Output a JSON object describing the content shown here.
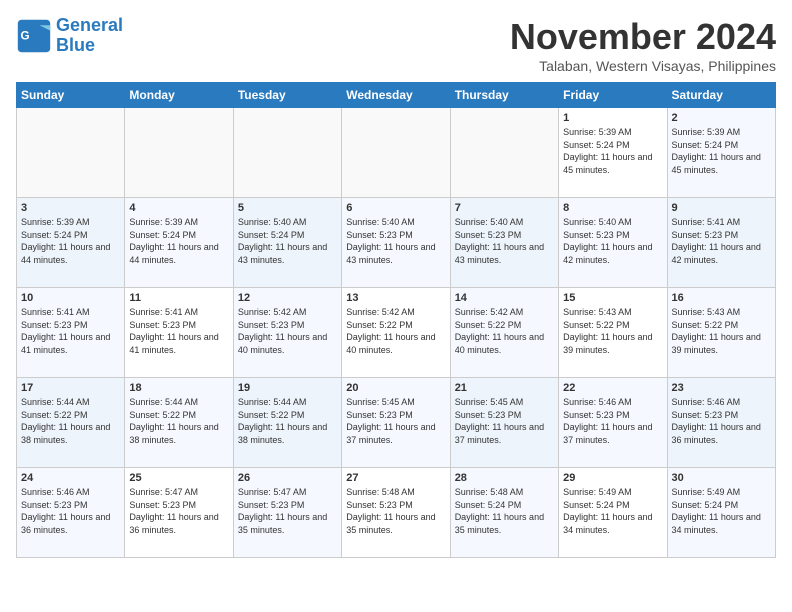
{
  "header": {
    "logo_line1": "General",
    "logo_line2": "Blue",
    "month": "November 2024",
    "location": "Talaban, Western Visayas, Philippines"
  },
  "weekdays": [
    "Sunday",
    "Monday",
    "Tuesday",
    "Wednesday",
    "Thursday",
    "Friday",
    "Saturday"
  ],
  "weeks": [
    [
      {
        "day": "",
        "info": ""
      },
      {
        "day": "",
        "info": ""
      },
      {
        "day": "",
        "info": ""
      },
      {
        "day": "",
        "info": ""
      },
      {
        "day": "",
        "info": ""
      },
      {
        "day": "1",
        "info": "Sunrise: 5:39 AM\nSunset: 5:24 PM\nDaylight: 11 hours and 45 minutes."
      },
      {
        "day": "2",
        "info": "Sunrise: 5:39 AM\nSunset: 5:24 PM\nDaylight: 11 hours and 45 minutes."
      }
    ],
    [
      {
        "day": "3",
        "info": "Sunrise: 5:39 AM\nSunset: 5:24 PM\nDaylight: 11 hours and 44 minutes."
      },
      {
        "day": "4",
        "info": "Sunrise: 5:39 AM\nSunset: 5:24 PM\nDaylight: 11 hours and 44 minutes."
      },
      {
        "day": "5",
        "info": "Sunrise: 5:40 AM\nSunset: 5:24 PM\nDaylight: 11 hours and 43 minutes."
      },
      {
        "day": "6",
        "info": "Sunrise: 5:40 AM\nSunset: 5:23 PM\nDaylight: 11 hours and 43 minutes."
      },
      {
        "day": "7",
        "info": "Sunrise: 5:40 AM\nSunset: 5:23 PM\nDaylight: 11 hours and 43 minutes."
      },
      {
        "day": "8",
        "info": "Sunrise: 5:40 AM\nSunset: 5:23 PM\nDaylight: 11 hours and 42 minutes."
      },
      {
        "day": "9",
        "info": "Sunrise: 5:41 AM\nSunset: 5:23 PM\nDaylight: 11 hours and 42 minutes."
      }
    ],
    [
      {
        "day": "10",
        "info": "Sunrise: 5:41 AM\nSunset: 5:23 PM\nDaylight: 11 hours and 41 minutes."
      },
      {
        "day": "11",
        "info": "Sunrise: 5:41 AM\nSunset: 5:23 PM\nDaylight: 11 hours and 41 minutes."
      },
      {
        "day": "12",
        "info": "Sunrise: 5:42 AM\nSunset: 5:23 PM\nDaylight: 11 hours and 40 minutes."
      },
      {
        "day": "13",
        "info": "Sunrise: 5:42 AM\nSunset: 5:22 PM\nDaylight: 11 hours and 40 minutes."
      },
      {
        "day": "14",
        "info": "Sunrise: 5:42 AM\nSunset: 5:22 PM\nDaylight: 11 hours and 40 minutes."
      },
      {
        "day": "15",
        "info": "Sunrise: 5:43 AM\nSunset: 5:22 PM\nDaylight: 11 hours and 39 minutes."
      },
      {
        "day": "16",
        "info": "Sunrise: 5:43 AM\nSunset: 5:22 PM\nDaylight: 11 hours and 39 minutes."
      }
    ],
    [
      {
        "day": "17",
        "info": "Sunrise: 5:44 AM\nSunset: 5:22 PM\nDaylight: 11 hours and 38 minutes."
      },
      {
        "day": "18",
        "info": "Sunrise: 5:44 AM\nSunset: 5:22 PM\nDaylight: 11 hours and 38 minutes."
      },
      {
        "day": "19",
        "info": "Sunrise: 5:44 AM\nSunset: 5:22 PM\nDaylight: 11 hours and 38 minutes."
      },
      {
        "day": "20",
        "info": "Sunrise: 5:45 AM\nSunset: 5:23 PM\nDaylight: 11 hours and 37 minutes."
      },
      {
        "day": "21",
        "info": "Sunrise: 5:45 AM\nSunset: 5:23 PM\nDaylight: 11 hours and 37 minutes."
      },
      {
        "day": "22",
        "info": "Sunrise: 5:46 AM\nSunset: 5:23 PM\nDaylight: 11 hours and 37 minutes."
      },
      {
        "day": "23",
        "info": "Sunrise: 5:46 AM\nSunset: 5:23 PM\nDaylight: 11 hours and 36 minutes."
      }
    ],
    [
      {
        "day": "24",
        "info": "Sunrise: 5:46 AM\nSunset: 5:23 PM\nDaylight: 11 hours and 36 minutes."
      },
      {
        "day": "25",
        "info": "Sunrise: 5:47 AM\nSunset: 5:23 PM\nDaylight: 11 hours and 36 minutes."
      },
      {
        "day": "26",
        "info": "Sunrise: 5:47 AM\nSunset: 5:23 PM\nDaylight: 11 hours and 35 minutes."
      },
      {
        "day": "27",
        "info": "Sunrise: 5:48 AM\nSunset: 5:23 PM\nDaylight: 11 hours and 35 minutes."
      },
      {
        "day": "28",
        "info": "Sunrise: 5:48 AM\nSunset: 5:24 PM\nDaylight: 11 hours and 35 minutes."
      },
      {
        "day": "29",
        "info": "Sunrise: 5:49 AM\nSunset: 5:24 PM\nDaylight: 11 hours and 34 minutes."
      },
      {
        "day": "30",
        "info": "Sunrise: 5:49 AM\nSunset: 5:24 PM\nDaylight: 11 hours and 34 minutes."
      }
    ]
  ]
}
